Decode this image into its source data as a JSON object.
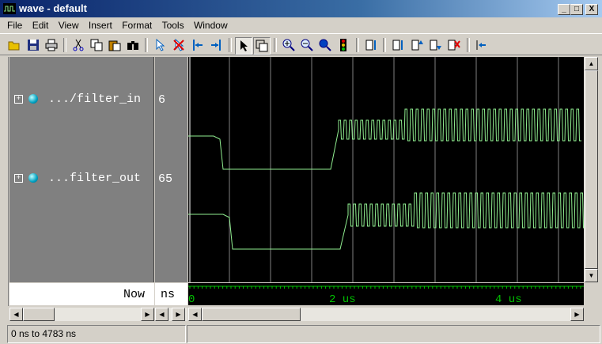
{
  "window": {
    "title": "wave - default",
    "minimize": "_",
    "maximize": "□",
    "close": "X"
  },
  "menu": [
    "File",
    "Edit",
    "View",
    "Insert",
    "Format",
    "Tools",
    "Window"
  ],
  "toolbar": [
    "open-folder-icon",
    "save-icon",
    "print-icon",
    "cut-icon",
    "copy-icon",
    "paste-icon",
    "find-icon",
    "select-cursor-icon",
    "delete-cursor-icon",
    "previous-edge-icon",
    "next-edge-icon",
    "pointer-icon",
    "zoom-mode-icon",
    "zoom-in-icon",
    "zoom-out-icon",
    "zoom-full-icon",
    "stop-icon",
    "expand-icon",
    "wave-insert-icon",
    "wave-up-icon",
    "wave-down-icon",
    "wave-delete-icon",
    "jump-icon"
  ],
  "signals": [
    {
      "name": ".../filter_in",
      "value": "6"
    },
    {
      "name": "...filter_out",
      "value": "65"
    }
  ],
  "cursor": {
    "now_label": "Now",
    "unit": "ns"
  },
  "axis": {
    "labels": [
      "0",
      "2 us",
      "4 us"
    ]
  },
  "status": {
    "range": "0 ns to 4783 ns"
  },
  "colors": {
    "wave": "#90ee90",
    "grid": "#808080",
    "cursor": "#ffffff",
    "axis": "#00c000",
    "background": "#000000"
  }
}
